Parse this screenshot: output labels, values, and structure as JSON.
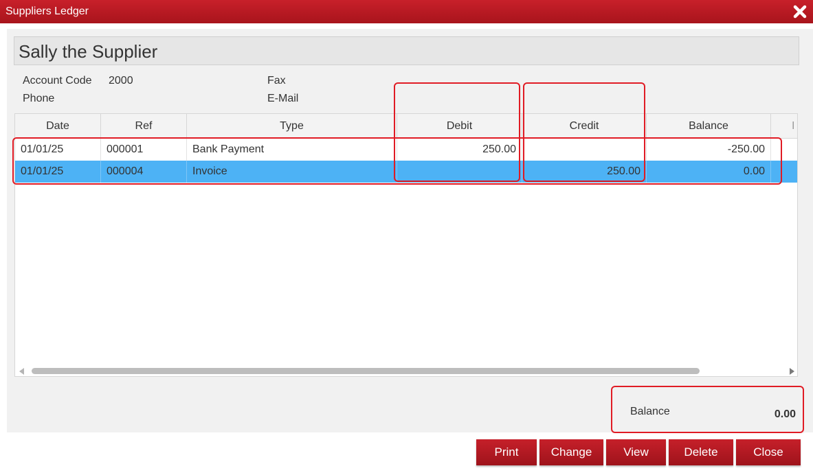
{
  "window": {
    "title": "Suppliers Ledger",
    "close_icon": "close-icon"
  },
  "supplier": {
    "name": "Sally the Supplier",
    "account_code_label": "Account Code",
    "account_code": "2000",
    "phone_label": "Phone",
    "phone": "",
    "fax_label": "Fax",
    "fax": "",
    "email_label": "E-Mail",
    "email": ""
  },
  "ledger": {
    "columns": [
      "Date",
      "Ref",
      "Type",
      "Debit",
      "Credit",
      "Balance",
      "I"
    ],
    "rows": [
      {
        "date": "01/01/25",
        "ref": "000001",
        "type": "Bank Payment",
        "debit": "250.00",
        "credit": "",
        "balance": "-250.00",
        "selected": false
      },
      {
        "date": "01/01/25",
        "ref": "000004",
        "type": "Invoice",
        "debit": "",
        "credit": "250.00",
        "balance": "0.00",
        "selected": true
      }
    ]
  },
  "footer": {
    "balance_label": "Balance",
    "balance_value": "0.00"
  },
  "buttons": {
    "print": "Print",
    "change": "Change",
    "view": "View",
    "delete": "Delete",
    "close": "Close"
  },
  "colors": {
    "titlebar": "#b3171f",
    "button": "#b3171f",
    "selected_row": "#4db2f5",
    "highlight": "#e01b24"
  }
}
